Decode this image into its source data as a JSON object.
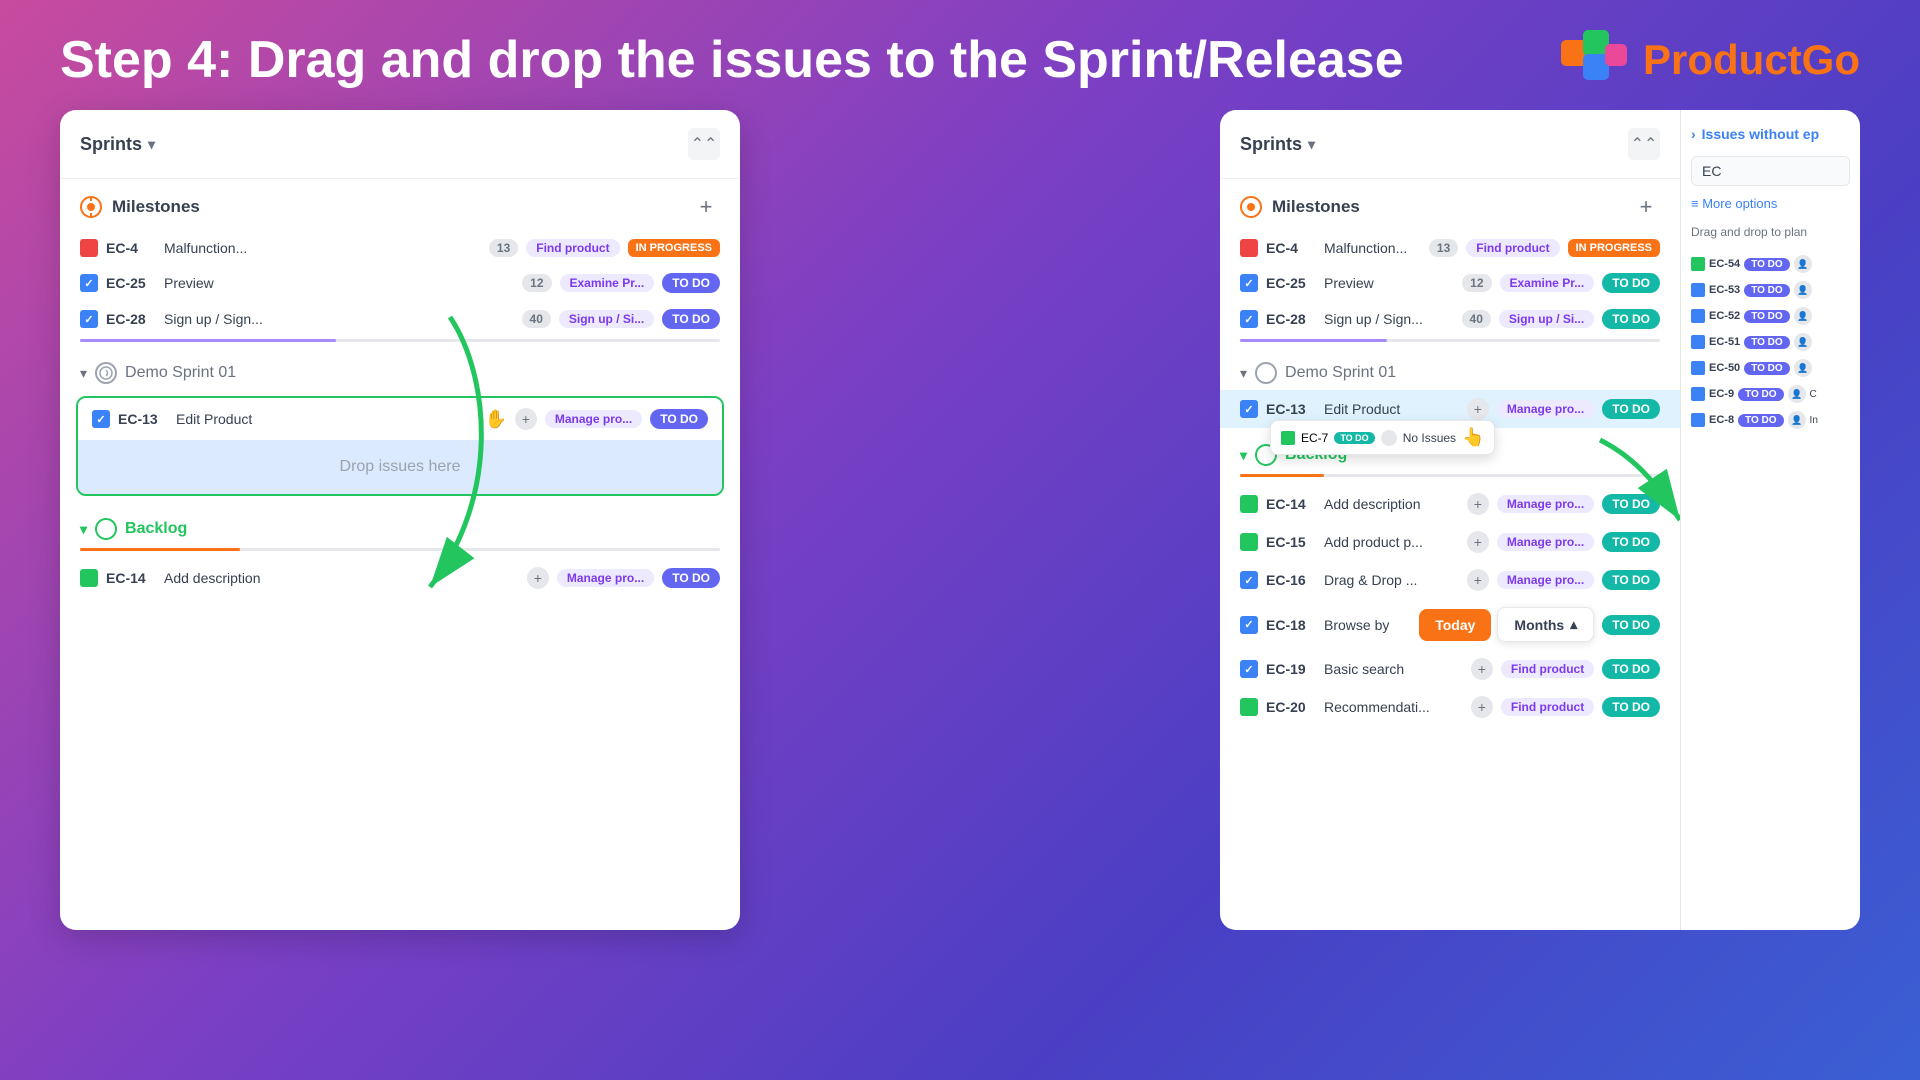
{
  "header": {
    "title": "Step 4: Drag and drop the issues to the Sprint/Release",
    "logo_text_product": "Product",
    "logo_text_go": "Go"
  },
  "left_panel": {
    "sprints_label": "Sprints",
    "collapse_icon": "⌃⌃",
    "milestones_label": "Milestones",
    "milestones_issues": [
      {
        "id": "EC-4",
        "name": "Malfunction...",
        "points": 13,
        "epic": "Find product",
        "status": "IN PROGRESS",
        "icon": "red"
      },
      {
        "id": "EC-25",
        "name": "Preview",
        "points": 12,
        "epic": "Examine Pr...",
        "status": "TO DO",
        "icon": "blue-check"
      },
      {
        "id": "EC-28",
        "name": "Sign up / Sign...",
        "points": 40,
        "epic": "Sign up / Si...",
        "status": "TO DO",
        "icon": "blue-check"
      }
    ],
    "sprint_label": "Demo Sprint 01",
    "sprint_issues": [
      {
        "id": "EC-13",
        "name": "Edit Product",
        "epic": "Manage pro...",
        "status": "TO DO",
        "icon": "blue-check"
      }
    ],
    "drop_placeholder": "Drop issues here",
    "backlog_label": "Backlog",
    "backlog_issues": [
      {
        "id": "EC-14",
        "name": "Add description",
        "epic": "Manage pro...",
        "status": "TO DO",
        "icon": "green"
      }
    ]
  },
  "right_panel": {
    "sprints_label": "Sprints",
    "milestones_label": "Milestones",
    "milestones_issues": [
      {
        "id": "EC-4",
        "name": "Malfunction...",
        "points": 13,
        "epic": "Find product",
        "status": "IN PROGRESS",
        "icon": "red"
      },
      {
        "id": "EC-25",
        "name": "Preview",
        "points": 12,
        "epic": "Examine Pr...",
        "status": "TO DO",
        "icon": "blue-check"
      },
      {
        "id": "EC-28",
        "name": "Sign up / Sign...",
        "points": 40,
        "epic": "Sign up / Si...",
        "status": "TO DO",
        "icon": "blue-check"
      }
    ],
    "sprint_label": "Demo Sprint 01",
    "sprint_issues": [
      {
        "id": "EC-13",
        "name": "Edit Product",
        "epic": "Manage pro...",
        "status": "TO DO",
        "icon": "blue-check"
      }
    ],
    "drag_item": {
      "id": "EC-7",
      "status": "TO DO",
      "label": "No Issues"
    },
    "backlog_label": "Backlog",
    "backlog_issues": [
      {
        "id": "EC-14",
        "name": "Add description",
        "epic": "Manage pro...",
        "status": "TO DO",
        "icon": "green"
      },
      {
        "id": "EC-15",
        "name": "Add product p...",
        "epic": "Manage pro...",
        "status": "TO DO",
        "icon": "green"
      },
      {
        "id": "EC-16",
        "name": "Drag & Drop ...",
        "epic": "Manage pro...",
        "status": "TO DO",
        "icon": "blue-check"
      },
      {
        "id": "EC-18",
        "name": "Browse by",
        "epic": "",
        "status": "TO DO",
        "icon": "blue-check"
      },
      {
        "id": "EC-19",
        "name": "Basic search",
        "epic": "Find product",
        "status": "TO DO",
        "icon": "blue-check"
      },
      {
        "id": "EC-20",
        "name": "Recommendati...",
        "epic": "Find product",
        "status": "TO DO",
        "icon": "green"
      }
    ],
    "popup_today": "Today",
    "popup_months": "Months"
  },
  "right_sidebar": {
    "expand_label": "Issues without ep",
    "search_value": "EC",
    "more_options": "≡ More options",
    "drag_hint": "Drag and drop to plan",
    "issues": [
      {
        "id": "EC-54",
        "status": "TO DO"
      },
      {
        "id": "EC-53",
        "status": "TO DO"
      },
      {
        "id": "EC-52",
        "status": "TO DO"
      },
      {
        "id": "EC-51",
        "status": "TO DO"
      },
      {
        "id": "EC-50",
        "status": "TO DO"
      },
      {
        "id": "EC-9",
        "status": "TO DO"
      },
      {
        "id": "EC-8",
        "status": "TO DO",
        "extra": "In"
      }
    ]
  }
}
